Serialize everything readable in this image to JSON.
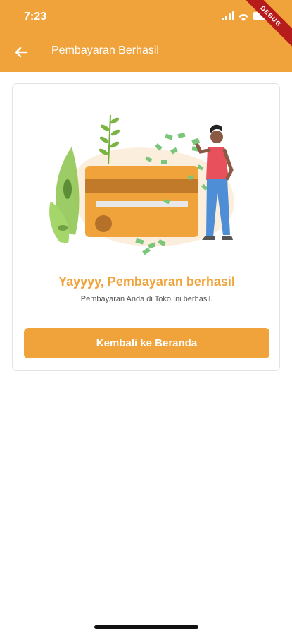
{
  "status": {
    "time": "7:23"
  },
  "debug_banner": "DEBUG",
  "appbar": {
    "title": "Pembayaran Berhasil"
  },
  "card": {
    "title": "Yayyyy, Pembayaran berhasil",
    "message": "Pembayaran Anda di Toko Ini berhasil.",
    "button_label": "Kembali ke Beranda"
  },
  "colors": {
    "accent": "#F0A33A",
    "money": "#7BC67B",
    "plant": "#8BC34A"
  }
}
